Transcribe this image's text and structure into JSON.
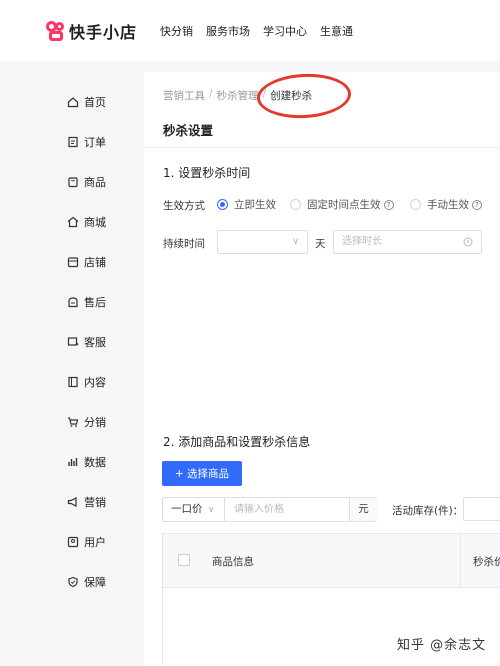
{
  "header": {
    "brand": "快手小店",
    "nav": [
      "快分销",
      "服务市场",
      "学习中心",
      "生意通"
    ]
  },
  "sidebar": {
    "items": [
      {
        "label": "首页",
        "icon": "home-icon"
      },
      {
        "label": "订单",
        "icon": "order-icon"
      },
      {
        "label": "商品",
        "icon": "product-icon"
      },
      {
        "label": "商城",
        "icon": "mall-icon"
      },
      {
        "label": "店铺",
        "icon": "store-icon"
      },
      {
        "label": "售后",
        "icon": "after-sales-icon"
      },
      {
        "label": "客服",
        "icon": "customer-service-icon"
      },
      {
        "label": "内容",
        "icon": "content-icon"
      },
      {
        "label": "分销",
        "icon": "distribution-icon"
      },
      {
        "label": "数据",
        "icon": "data-icon"
      },
      {
        "label": "营销",
        "icon": "marketing-icon"
      },
      {
        "label": "用户",
        "icon": "user-icon"
      },
      {
        "label": "保障",
        "icon": "shield-icon"
      }
    ]
  },
  "breadcrumb": [
    "营销工具",
    "秒杀管理",
    "创建秒杀"
  ],
  "page_title": "秒杀设置",
  "section1": {
    "title": "1. 设置秒杀时间",
    "effect_label": "生效方式",
    "effect_options": [
      {
        "label": "立即生效",
        "selected": true,
        "help": false
      },
      {
        "label": "固定时间点生效",
        "selected": false,
        "help": true
      },
      {
        "label": "手动生效",
        "selected": false,
        "help": true
      }
    ],
    "duration_label": "持续时间",
    "duration_value": "",
    "duration_unit": "天",
    "time_placeholder": "选择时长"
  },
  "section2": {
    "title": "2. 添加商品和设置秒杀信息",
    "add_button": "+ 选择商品",
    "price_type": "一口价",
    "price_placeholder": "请输入价格",
    "price_unit": "元",
    "stock_label": "活动库存(件)："
  },
  "table": {
    "columns": [
      "商品信息",
      "秒杀价"
    ]
  },
  "watermark": "知乎 @余志文",
  "colors": {
    "accent": "#326bfb",
    "brand": "#fe3666",
    "annotation": "#e33a2c"
  }
}
